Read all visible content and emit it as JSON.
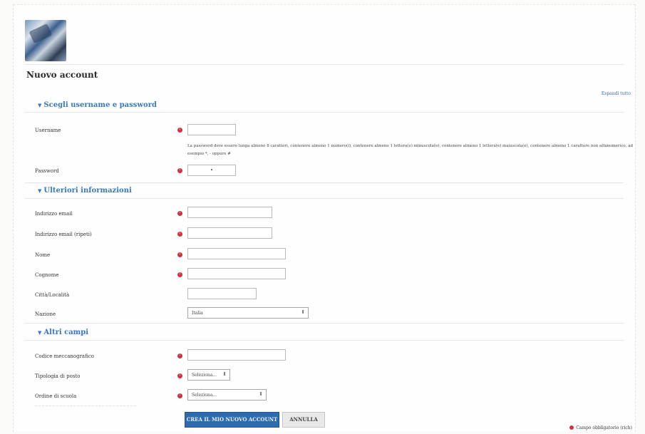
{
  "page": {
    "title": "Nuovo account",
    "expand_all": "Espandi tutto"
  },
  "sections": {
    "credentials": "Scegli username e password",
    "more_info": "Ulteriori informazioni",
    "other_fields": "Altri campi"
  },
  "fields": {
    "username_label": "Username",
    "username_value": "",
    "password_help": "La password deve essere lunga almeno 8 caratteri, contenere almeno 1 numero(i), contenere almeno 1 lettera(e) minuscola(e), contenere almeno 1 lettera(e) maiuscola(e), contenere almeno 1 carattere non alfanumerico, ad esempio *, - oppure #",
    "password_label": "Password",
    "password_value": "•",
    "email_label": "Indirizzo email",
    "email_value": "",
    "email_again_label": "Indirizzo email (ripeti)",
    "email_again_value": "",
    "firstname_label": "Nome",
    "firstname_value": "",
    "lastname_label": "Cognome",
    "lastname_value": "",
    "city_label": "Città/Località",
    "city_value": "",
    "country_label": "Nazione",
    "country_value": "Italia",
    "mechanographic_label": "Codice meccanografico",
    "mechanographic_value": "",
    "post_type_label": "Tipologia di posto",
    "post_type_value": "Seleziona...",
    "school_order_label": "Ordine di scuola",
    "school_order_value": "Seleziona..."
  },
  "buttons": {
    "create": "CREA IL MIO NUOVO ACCOUNT",
    "cancel": "ANNULLA"
  },
  "footer": {
    "required_note": "Campo obbligatorio (rich)"
  },
  "colors": {
    "accent": "#3a77c2",
    "required": "#d62f3a",
    "primary_button": "#2e6cb0"
  }
}
